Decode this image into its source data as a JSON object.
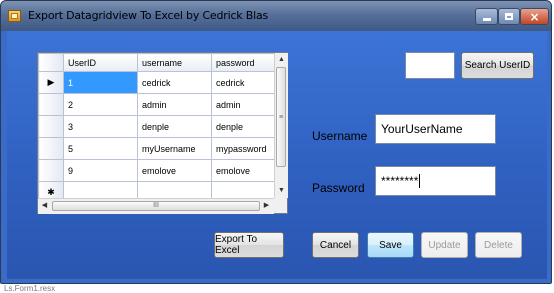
{
  "window": {
    "title": "Export Datagridview To Excel by Cedrick Blas",
    "controls": {
      "minimize": "",
      "maximize": "",
      "close": "×"
    }
  },
  "grid": {
    "columns": [
      "UserID",
      "username",
      "password"
    ],
    "rows": [
      {
        "indicator": "▶",
        "userid": "1",
        "username": "cedrick",
        "password": "cedrick",
        "selected": true
      },
      {
        "indicator": "",
        "userid": "2",
        "username": "admin",
        "password": "admin"
      },
      {
        "indicator": "",
        "userid": "3",
        "username": "denple",
        "password": "denple"
      },
      {
        "indicator": "",
        "userid": "5",
        "username": "myUsername",
        "password": "mypassword"
      },
      {
        "indicator": "",
        "userid": "9",
        "username": "emolove",
        "password": "emolove"
      },
      {
        "indicator": "✱",
        "userid": "",
        "username": "",
        "password": ""
      }
    ],
    "scroll": {
      "up": "▲",
      "down": "▼",
      "left": "◀",
      "right": "▶",
      "vgrip": "≡",
      "hgrip": "III"
    }
  },
  "search": {
    "value": "",
    "button_label": "Search UserID"
  },
  "form": {
    "username_label": "Username",
    "username_value": "YourUserName",
    "password_label": "Password",
    "password_value": "********"
  },
  "buttons": {
    "export": "Export To Excel",
    "cancel": "Cancel",
    "save": "Save",
    "update": "Update",
    "delete": "Delete"
  },
  "statusbar": {
    "text": "Ls.Form1.resx"
  }
}
